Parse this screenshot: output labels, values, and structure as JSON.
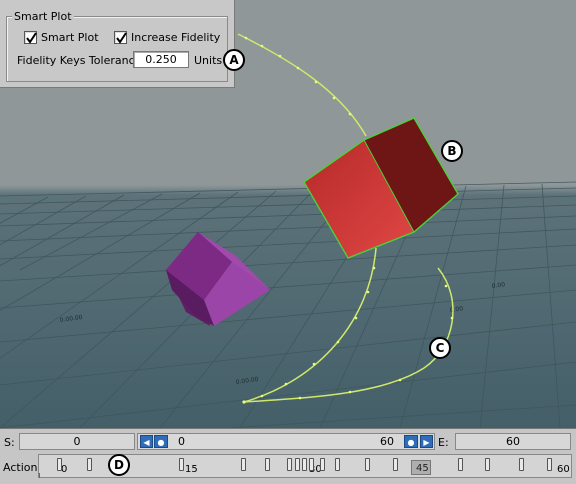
{
  "smart_plot": {
    "group_title": "Smart Plot",
    "smart_plot_label": "Smart Plot",
    "smart_plot_checked": true,
    "increase_fidelity_label": "Increase Fidelity",
    "increase_fidelity_checked": true,
    "tolerance_label": "Fidelity Keys Tolerance",
    "tolerance_value": "0.250",
    "units_label": "Units"
  },
  "callouts": {
    "a": "A",
    "b": "B",
    "c": "C",
    "d": "D"
  },
  "scene": {
    "selected_cube_color": "#d43a38",
    "selected_outline_color": "#4bd13a",
    "trajectory_color": "#cfe86a",
    "second_cube_color": "#9a3fa2"
  },
  "transport": {
    "s_label": "S:",
    "start_value": "0",
    "range_start": "0",
    "range_end": "60",
    "e_label": "E:",
    "end_value": "60",
    "action_label": "Action",
    "timeline_labels": [
      "0",
      "15",
      "30",
      "45",
      "60"
    ],
    "current_frame": "45"
  }
}
